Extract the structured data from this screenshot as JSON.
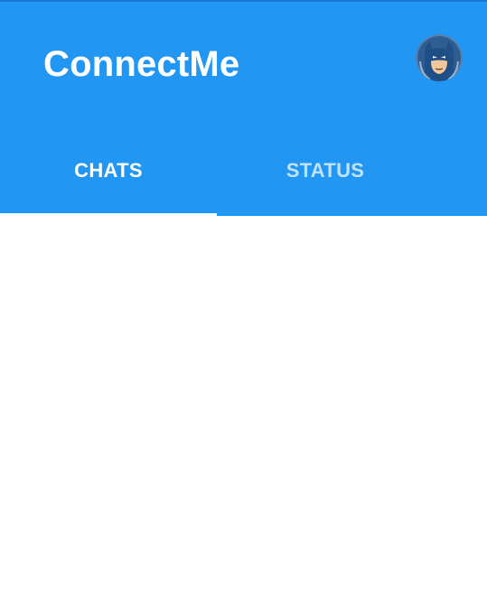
{
  "app": {
    "title": "ConnectMe",
    "avatar_icon": "superhero-mask-avatar-icon"
  },
  "tabs": [
    {
      "label": "CHATS",
      "active": true
    },
    {
      "label": "STATUS",
      "active": false
    }
  ],
  "colors": {
    "primary": "#2196F3",
    "primary_dark": "#1976D2",
    "indicator": "#FFFFFF",
    "background": "#FFFFFF"
  }
}
